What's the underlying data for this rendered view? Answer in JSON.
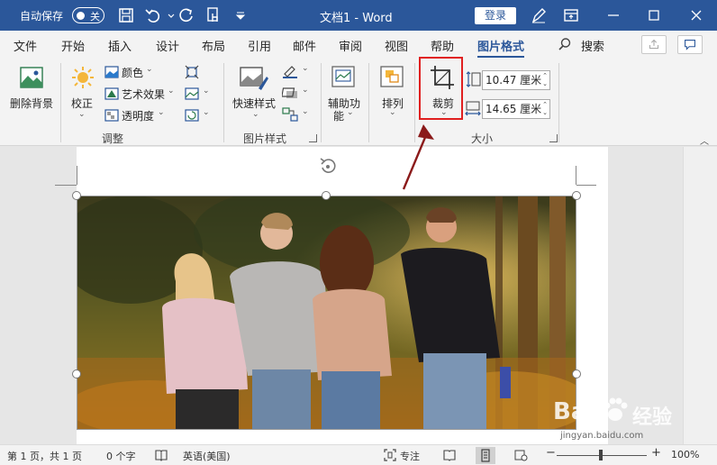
{
  "titlebar": {
    "autosave_label": "自动保存",
    "autosave_state": "关",
    "doc_title": "文档1  -  Word",
    "login_label": "登录"
  },
  "tabs": [
    {
      "label": "文件"
    },
    {
      "label": "开始"
    },
    {
      "label": "插入"
    },
    {
      "label": "设计"
    },
    {
      "label": "布局"
    },
    {
      "label": "引用"
    },
    {
      "label": "邮件"
    },
    {
      "label": "审阅"
    },
    {
      "label": "视图"
    },
    {
      "label": "帮助"
    },
    {
      "label": "图片格式"
    }
  ],
  "search_label": "搜索",
  "ribbon": {
    "remove_bg": "删除背景",
    "correct": "校正",
    "color": "颜色",
    "artistic": "艺术效果",
    "transparency": "透明度",
    "group_adjust": "调整",
    "quick_styles": "快速样式",
    "group_styles": "图片样式",
    "accessibility_line1": "辅助功",
    "accessibility_line2": "能",
    "arrange": "排列",
    "crop": "裁剪",
    "height": "10.47 厘米",
    "width": "14.65 厘米",
    "group_size": "大小"
  },
  "status": {
    "page": "第 1 页，共 1 页",
    "words": "0 个字",
    "language": "英语(美国)",
    "focus": "专注",
    "zoom_minus": "−",
    "zoom_plus": "+",
    "zoom": "100%"
  },
  "colors": {
    "title_bar": "#2b579a",
    "highlight": "#e02020",
    "arrow": "#8b1a1a"
  },
  "watermark": {
    "brand": "Bai",
    "brand_cn": "经验",
    "url": "jingyan.baidu.com"
  }
}
